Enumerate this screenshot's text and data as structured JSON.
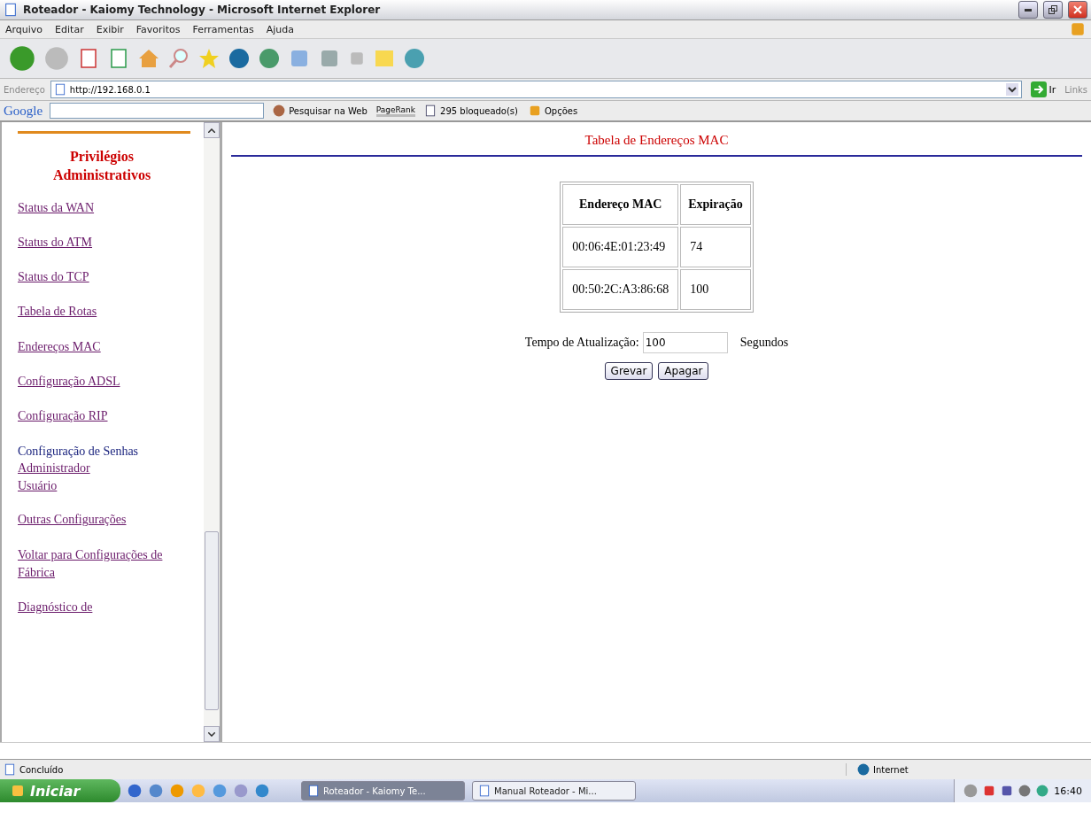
{
  "window": {
    "title": "Roteador - Kaiomy Technology - Microsoft Internet Explorer"
  },
  "menu": [
    "Arquivo",
    "Editar",
    "Exibir",
    "Favoritos",
    "Ferramentas",
    "Ajuda"
  ],
  "address_bar": {
    "label": "Endereço",
    "url": "http://192.168.0.1",
    "go": "Ir",
    "links": "Links"
  },
  "google_bar": {
    "logo": "Google",
    "search": "Pesquisar na Web",
    "pagerank": "PageRank",
    "blocked": "295 bloqueado(s)",
    "options": "Opções"
  },
  "sidebar": {
    "heading": "Privilégios Administrativos",
    "items": [
      {
        "label": "Status da WAN",
        "kind": "link"
      },
      {
        "label": "Status do ATM",
        "kind": "link"
      },
      {
        "label": "Status do TCP",
        "kind": "link"
      },
      {
        "label": "Tabela de Rotas",
        "kind": "link"
      },
      {
        "label": "Endereços MAC",
        "kind": "link"
      },
      {
        "label": "Configuração ADSL",
        "kind": "link"
      },
      {
        "label": "Configuração RIP",
        "kind": "link"
      },
      {
        "label": "Configuração de Senhas",
        "kind": "group",
        "children": [
          {
            "label": "Administrador"
          },
          {
            "label": "Usuário"
          }
        ]
      },
      {
        "label": "Outras Configurações",
        "kind": "link"
      },
      {
        "label": "Voltar para Configurações de Fábrica",
        "kind": "link"
      },
      {
        "label": "Diagnóstico de",
        "kind": "link"
      }
    ]
  },
  "main": {
    "title": "Tabela de Endereços MAC",
    "table": {
      "columns": [
        "Endereço MAC",
        "Expiração"
      ],
      "rows": [
        [
          "00:06:4E:01:23:49",
          "74"
        ],
        [
          "00:50:2C:A3:86:68",
          "100"
        ]
      ]
    },
    "refresh": {
      "label": "Tempo de Atualização:",
      "value": "100",
      "unit": "Segundos"
    },
    "buttons": [
      "Grevar",
      "Apagar"
    ]
  },
  "status_bar": {
    "text": "Concluído",
    "zone": "Internet"
  },
  "taskbar": {
    "start": "Iniciar",
    "tasks": [
      {
        "label": "Roteador - Kaiomy Te...",
        "selected": true
      },
      {
        "label": "Manual Roteador - Mi...",
        "selected": false
      }
    ],
    "clock": "16:40"
  }
}
